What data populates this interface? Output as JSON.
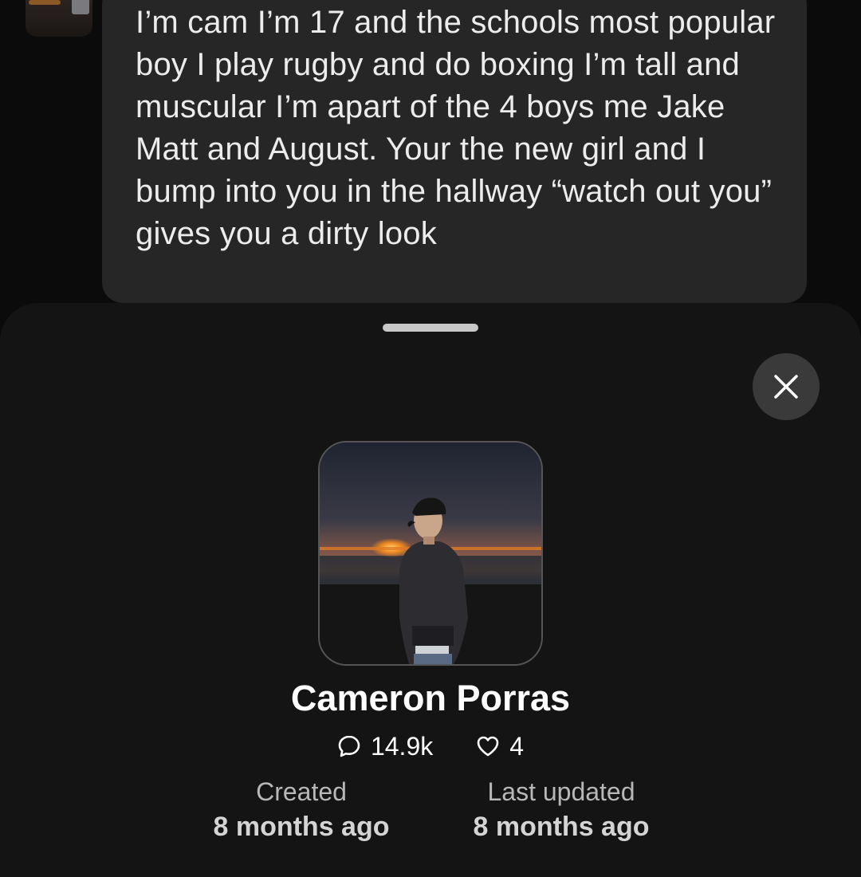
{
  "message": {
    "text": "I’m cam I’m 17 and the schools most popular boy I play rugby and do boxing I’m tall and muscular I’m apart of the 4 boys me Jake Matt and August. Your the new girl and I bump into you in the hallway “watch out you” gives you a dirty look"
  },
  "sheet": {
    "close_icon": "close-icon",
    "profile": {
      "name": "Cameron Porras",
      "chats_icon": "chat-bubble-icon",
      "chats_count": "14.9k",
      "likes_icon": "heart-icon",
      "likes_count": "4"
    },
    "created": {
      "label": "Created",
      "value": "8 months ago"
    },
    "updated": {
      "label": "Last updated",
      "value": "8 months ago"
    }
  },
  "colors": {
    "sheet_bg": "#141414",
    "bubble_bg": "#262626",
    "close_button_bg": "#3a3a3a"
  }
}
